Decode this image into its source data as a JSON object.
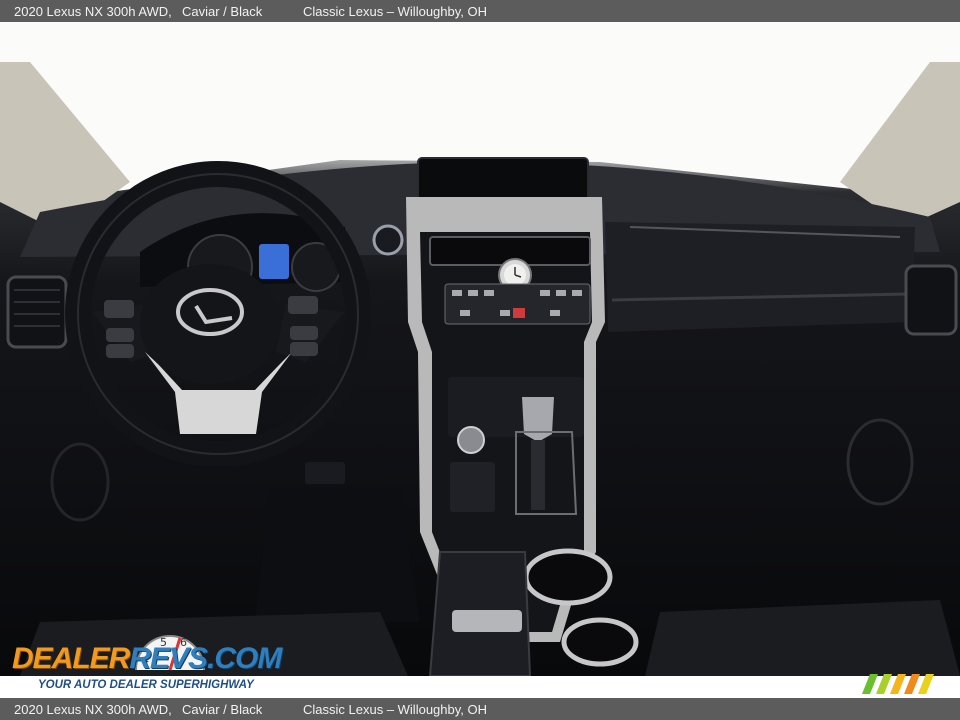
{
  "caption": {
    "model": "2020 Lexus NX 300h AWD,",
    "trim": "Caviar / Black",
    "dealer": "Classic Lexus – Willoughby, OH"
  },
  "watermark": {
    "brand_word_1": "DEALER",
    "brand_word_2": "REVS",
    "brand_suffix": ".COM",
    "tagline": "YOUR AUTO DEALER SUPERHIGHWAY",
    "accent_orange": "#f19a1e",
    "accent_blue": "#2f7fbf"
  },
  "photo": {
    "subject": "vehicle-interior-dashboard",
    "interior_color": "#0c0d10",
    "trim_color": "#c9c9c9"
  }
}
